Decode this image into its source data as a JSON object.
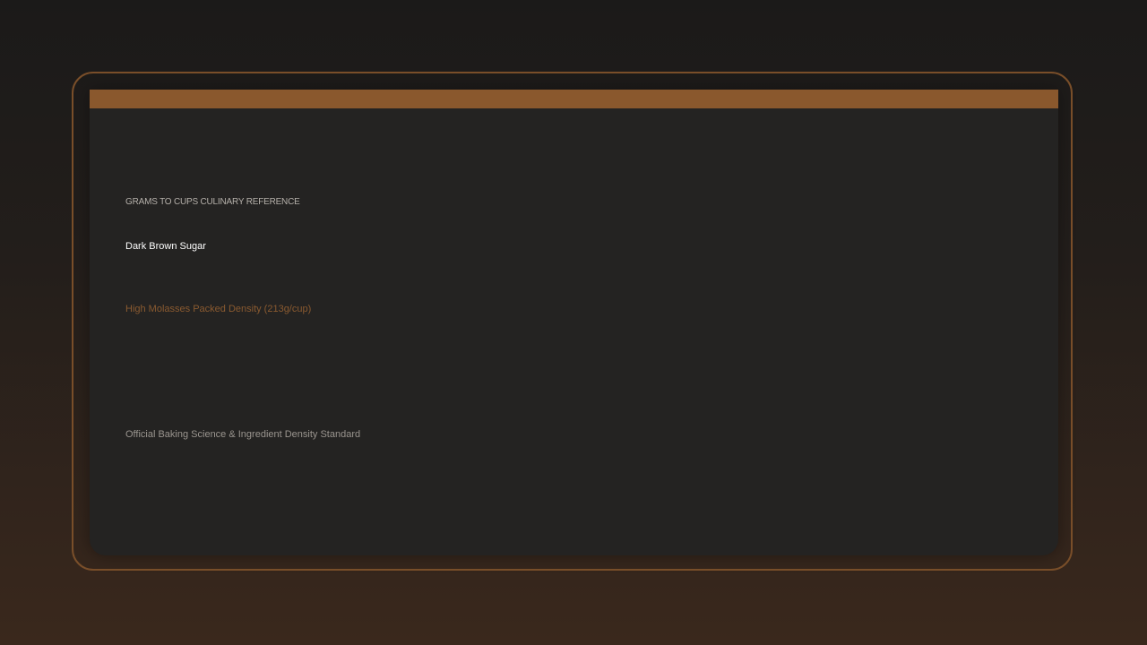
{
  "colors": {
    "accent": "#8a582d",
    "card_background": "#242322",
    "frame_border": "#7a4f2a",
    "highlight_text": "#8a5a30"
  },
  "card": {
    "eyebrow": "GRAMS TO CUPS CULINARY REFERENCE",
    "ingredient_name": "Dark Brown Sugar",
    "density_note": "High Molasses Packed Density (213g/cup)",
    "footer_source": "Official Baking Science & Ingredient Density Standard"
  }
}
